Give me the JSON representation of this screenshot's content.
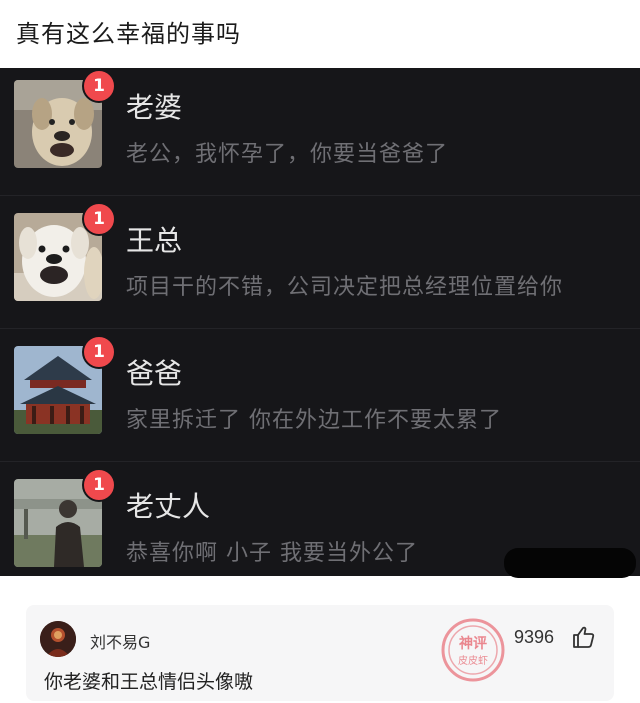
{
  "post": {
    "title": "真有这么幸福的事吗"
  },
  "chats": [
    {
      "name": "老婆",
      "preview": "老公，我怀孕了，你要当爸爸了",
      "badge": "1",
      "avatar_icon": "dog-avatar"
    },
    {
      "name": "王总",
      "preview": "项目干的不错，公司决定把总经理位置给你",
      "badge": "1",
      "avatar_icon": "dog-avatar"
    },
    {
      "name": "爸爸",
      "preview": "家里拆迁了 你在外边工作不要太累了",
      "badge": "1",
      "avatar_icon": "pavilion-avatar"
    },
    {
      "name": "老丈人",
      "preview": "恭喜你啊 小子 我要当外公了",
      "badge": "1",
      "avatar_icon": "person-avatar"
    }
  ],
  "comment": {
    "username": "刘不易G",
    "text": "你老婆和王总情侣头像嗷",
    "likes": "9396",
    "stamp_text": "神评 皮皮虾"
  },
  "colors": {
    "chat_bg": "#161619",
    "badge": "#f0494d",
    "name": "#e6e6e6",
    "preview": "#6f6f74",
    "stamp": "#e8737c"
  }
}
